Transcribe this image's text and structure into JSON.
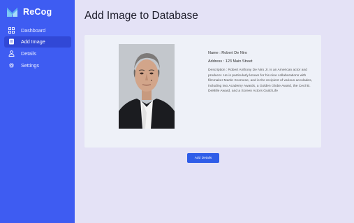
{
  "app": {
    "name": "ReCog",
    "logo_icon": "recog-logo-icon"
  },
  "sidebar": {
    "items": [
      {
        "label": "Dashboard",
        "icon": "dashboard-grid-icon",
        "active": false
      },
      {
        "label": "Add Image",
        "icon": "document-icon",
        "active": true
      },
      {
        "label": "Details",
        "icon": "user-icon",
        "active": false
      },
      {
        "label": "Settings",
        "icon": "gear-icon",
        "active": false
      }
    ]
  },
  "page": {
    "title": "Add Image to Database"
  },
  "record": {
    "name_line": "Name : Robert De Niro",
    "address_line": "Address : 123 Main Street",
    "description_line": "Description : Robert Anthony De Niro Jr. is an American actor and producer. He is particularly known for his nine collaborations with filmmaker Martin Scorsese, and is the recipient of various accolades, including two Academy Awards, a Golden Globe Award, the Cecil B. DeMille Award, and a Screen Actors Guild Life"
  },
  "actions": {
    "add_button_label": "Add Details"
  },
  "colors": {
    "sidebar": "#3e5cf2",
    "active_item": "#3148d6",
    "background": "#e4e2f6",
    "card": "#eef1f8",
    "button": "#2f5de8"
  }
}
